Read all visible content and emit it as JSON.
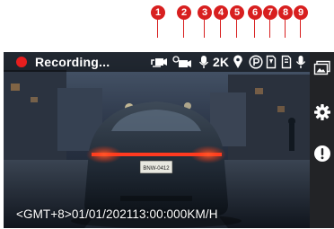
{
  "callouts": [
    "1",
    "2",
    "3",
    "4",
    "5",
    "6",
    "7",
    "8",
    "9"
  ],
  "status": {
    "recording_label": "Recording...",
    "resolution": "2K"
  },
  "icons": {
    "status": [
      "loop-recording-icon",
      "timelapse-camera-icon",
      "microphone-gps-icon",
      "resolution-indicator",
      "location-pin-icon",
      "parking-mode-icon",
      "sd-card-icon",
      "sd-card-alt-icon",
      "microphone-icon"
    ],
    "sidebar": [
      "gallery-icon",
      "settings-icon",
      "alert-icon"
    ]
  },
  "overlay": {
    "datetime": "<GMT+8>01/01/202113:00:00",
    "speed": "0KM/H"
  },
  "plate_text": "BNW-0412",
  "colors": {
    "callout_red": "#d81f1f",
    "recording_red": "#e61e1e",
    "sidebar_bg": "#222326"
  }
}
